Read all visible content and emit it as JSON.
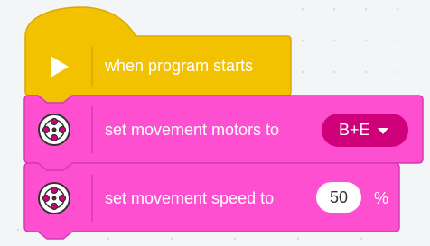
{
  "colors": {
    "event_block": "#f2c200",
    "event_block_border": "#d9a800",
    "motor_block": "#ff4fd1",
    "motor_block_border": "#d43bb0",
    "dropdown_pill": "#d0007a"
  },
  "blocks": [
    {
      "id": "when-program-starts",
      "category": "events",
      "icon": "play-icon",
      "label": "when program starts"
    },
    {
      "id": "set-movement-motors",
      "category": "movement",
      "icon": "motor-pair-icon",
      "label": "set movement motors to",
      "dropdown_value": "B+E"
    },
    {
      "id": "set-movement-speed",
      "category": "movement",
      "icon": "motor-pair-icon",
      "label": "set movement speed to",
      "input_value": "50",
      "suffix": "%"
    }
  ]
}
